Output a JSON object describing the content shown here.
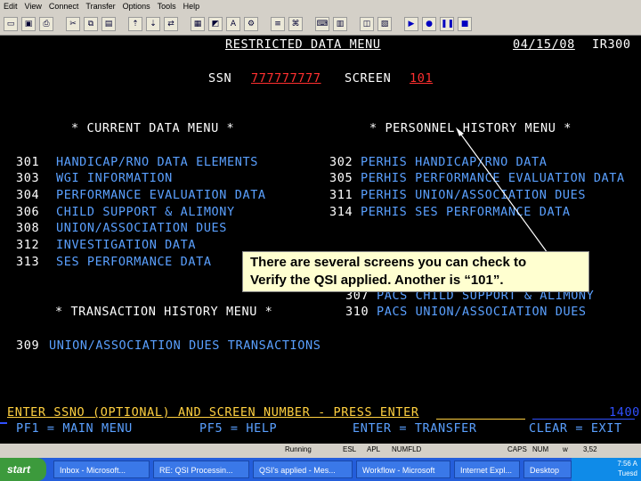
{
  "menubar": {
    "items": [
      "Edit",
      "View",
      "Connect",
      "Transfer",
      "Options",
      "Tools",
      "Help"
    ]
  },
  "screen": {
    "title": "RESTRICTED DATA MENU",
    "date": "04/15/08",
    "code": "IR300",
    "ssn_label": "SSN",
    "ssn_value": "777777777",
    "screen_label": "SCREEN",
    "screen_value": "101",
    "current_header": "* CURRENT DATA MENU *",
    "personnel_header": "* PERSONNEL HISTORY MENU *",
    "current_items": [
      {
        "code": "301",
        "label": "HANDICAP/RNO DATA ELEMENTS"
      },
      {
        "code": "303",
        "label": "WGI INFORMATION"
      },
      {
        "code": "304",
        "label": "PERFORMANCE EVALUATION DATA"
      },
      {
        "code": "306",
        "label": "CHILD SUPPORT & ALIMONY"
      },
      {
        "code": "308",
        "label": "UNION/ASSOCIATION DUES"
      },
      {
        "code": "312",
        "label": "INVESTIGATION DATA"
      },
      {
        "code": "313",
        "label": "SES PERFORMANCE DATA"
      }
    ],
    "personnel_items": [
      {
        "code": "302",
        "label": "PERHIS HANDICAP/RNO DATA"
      },
      {
        "code": "305",
        "label": "PERHIS PERFORMANCE EVALUATION DATA"
      },
      {
        "code": "311",
        "label": "PERHIS UNION/ASSOCIATION DUES"
      },
      {
        "code": "314",
        "label": "PERHIS SES PERFORMANCE DATA"
      }
    ],
    "pacs_items": [
      {
        "code": "307",
        "label": "PACS CHILD SUPPORT & ALIMONY"
      },
      {
        "code": "310",
        "label": "PACS UNION/ASSOCIATION DUES"
      }
    ],
    "transaction_header": "* TRANSACTION HISTORY MENU *",
    "transaction_item": {
      "code": "309",
      "label": "UNION/ASSOCIATION DUES TRANSACTIONS"
    },
    "prompt": "ENTER SSNO (OPTIONAL) AND SCREEN NUMBER - PRESS ENTER",
    "prompt_right": "1400",
    "pf1": "PF1 = MAIN MENU",
    "pf5": "PF5 = HELP",
    "enter_key": "ENTER = TRANSFER",
    "clear_key": "CLEAR = EXIT"
  },
  "callout": {
    "line1": "There are several screens you can check to",
    "line2": "Verify the QSI applied.  Another is “101”."
  },
  "statusbar": {
    "items": [
      "Running",
      "ESL",
      "APL",
      "NUMFLD",
      "CAPS",
      "NUM",
      "w",
      "3,52"
    ]
  },
  "taskbar": {
    "start_label": "start",
    "tasks": [
      "Inbox - Microsoft...",
      "RE: QSI Processin...",
      "QSI's applied - Mes...",
      "Workflow - Microsoft",
      "Internet Expl...",
      "Desktop"
    ],
    "time": "7:56 A",
    "day": "Tuesd"
  },
  "colors": {
    "terminal_bg": "#000000",
    "text_blue": "#5aa0ff",
    "highlight_red": "#ff3030",
    "callout_bg": "#ffffd0"
  }
}
